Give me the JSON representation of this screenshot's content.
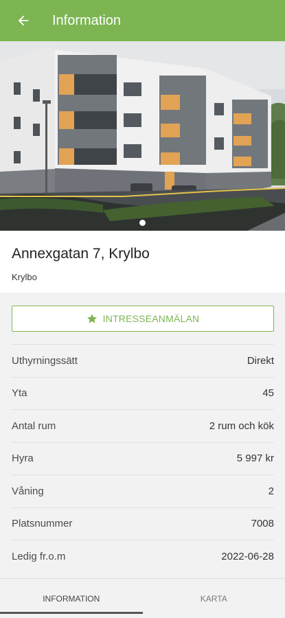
{
  "appbar": {
    "title": "Information",
    "back_icon": "arrow-left-icon"
  },
  "colors": {
    "brand_green": "#7cb552"
  },
  "gallery": {
    "dot_count": 1,
    "active_index": 0
  },
  "property": {
    "address": "Annexgatan 7, Krylbo",
    "city": "Krylbo"
  },
  "interest_button": {
    "label": "INTRESSEANMÄLAN",
    "icon": "star-icon"
  },
  "details": [
    {
      "label": "Uthyrningssätt",
      "value": "Direkt"
    },
    {
      "label": "Yta",
      "value": "45"
    },
    {
      "label": "Antal rum",
      "value": "2 rum och kök"
    },
    {
      "label": "Hyra",
      "value": "5 997 kr"
    },
    {
      "label": "Våning",
      "value": "2"
    },
    {
      "label": "Platsnummer",
      "value": "7008"
    },
    {
      "label": "Ledig fr.o.m",
      "value": "2022-06-28"
    }
  ],
  "bottom_nav": {
    "tabs": [
      {
        "label": "INFORMATION",
        "active": true
      },
      {
        "label": "KARTA",
        "active": false
      }
    ]
  }
}
